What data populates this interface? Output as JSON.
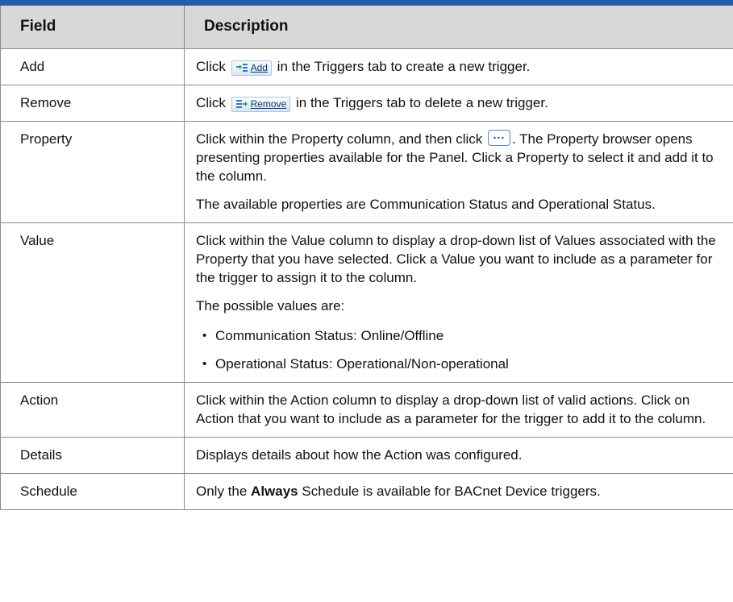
{
  "table": {
    "headers": {
      "field": "Field",
      "description": "Description"
    },
    "rows": {
      "add": {
        "field": "Add",
        "pre": "Click",
        "button_label": "Add",
        "post": " in the Triggers tab to create a new trigger."
      },
      "remove": {
        "field": "Remove",
        "pre": "Click",
        "button_label": "Remove",
        "post": " in the Triggers tab to delete a new trigger."
      },
      "property": {
        "field": "Property",
        "p1_pre": "Click within the Property column, and then click",
        "p1_post": ". The Property browser opens presenting properties available for the Panel. Click a Property to select it and add it to the column.",
        "p2": "The available properties are Communication Status and Operational Status."
      },
      "value": {
        "field": "Value",
        "p1": "Click within the Value column to display a drop-down list of Values associated with the Property that you have selected. Click a Value you want to include as a parameter for the trigger to assign it to the column.",
        "p2": "The possible values are:",
        "bullets": [
          "Communication Status: Online/Offline",
          "Operational Status: Operational/Non-operational"
        ]
      },
      "action": {
        "field": "Action",
        "p1": "Click within the Action column to display a drop-down list of valid actions. Click on Action that you want to include as a parameter for the trigger to add it to the column."
      },
      "details": {
        "field": "Details",
        "p1": "Displays details about how the Action was configured."
      },
      "schedule": {
        "field": "Schedule",
        "pre": "Only the ",
        "bold": "Always",
        "post": " Schedule is available for BACnet Device triggers."
      }
    }
  },
  "icons": {
    "add": "add-list-icon",
    "remove": "remove-list-icon",
    "browse": "ellipsis-icon"
  },
  "colors": {
    "header_rule": "#1f5fb0",
    "header_bg": "#d8d8d8",
    "border": "#8a8a8a"
  }
}
